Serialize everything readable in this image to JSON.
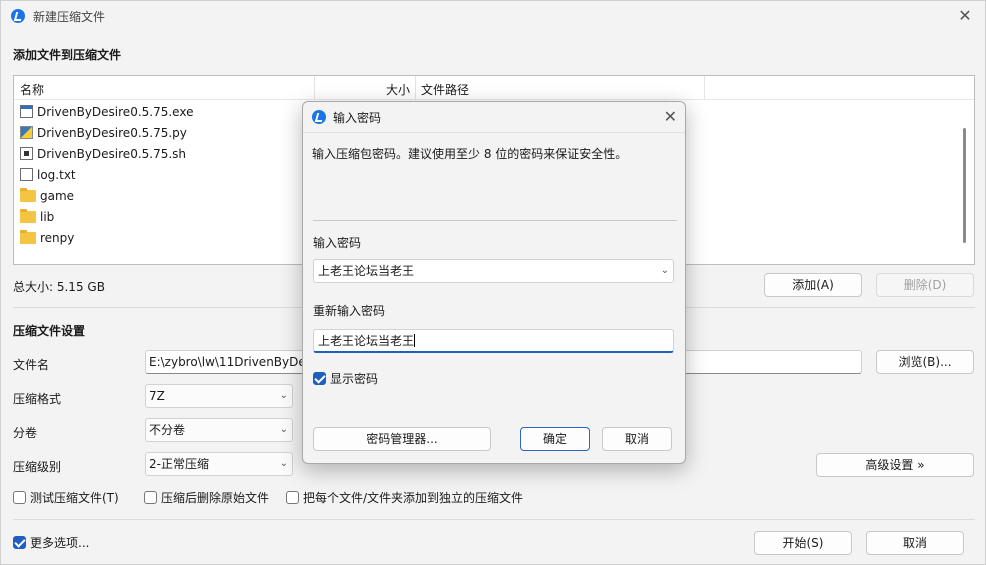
{
  "window": {
    "title": "新建压缩文件",
    "close_symbol": "✕",
    "add_section_title": "添加文件到压缩文件",
    "list": {
      "columns": [
        "名称",
        "大小",
        "文件路径"
      ],
      "rows": [
        {
          "name": "DrivenByDesire0.5.75.exe",
          "icon": "exe-file-icon"
        },
        {
          "name": "DrivenByDesire0.5.75.py",
          "icon": "python-file-icon"
        },
        {
          "name": "DrivenByDesire0.5.75.sh",
          "icon": "shell-file-icon"
        },
        {
          "name": "log.txt",
          "icon": "text-file-icon"
        },
        {
          "name": "game",
          "icon": "folder-icon"
        },
        {
          "name": "lib",
          "icon": "folder-icon"
        },
        {
          "name": "renpy",
          "icon": "folder-icon"
        }
      ]
    },
    "total_size": "总大小: 5.15 GB",
    "add_button": "添加(A)",
    "delete_button": "删除(D)",
    "settings_title": "压缩文件设置",
    "filename_label": "文件名",
    "filename_value": "E:\\zybro\\lw\\11DrivenByDesi",
    "browse_button": "浏览(B)...",
    "format_label": "压缩格式",
    "format_value": "7Z",
    "split_label": "分卷",
    "split_value": "不分卷",
    "level_label": "压缩级别",
    "level_value": "2-正常压缩",
    "advanced_button": "高级设置 »",
    "test_checkbox": "测试压缩文件(T)",
    "delete_after_checkbox": "压缩后删除原始文件",
    "separate_checkbox": "把每个文件/文件夹添加到独立的压缩文件",
    "more_options": "更多选项...",
    "start_button": "开始(S)",
    "cancel_button": "取消"
  },
  "dialog": {
    "title": "输入密码",
    "close_symbol": "✕",
    "description": "输入压缩包密码。建议使用至少 8 位的密码来保证安全性。",
    "password_label": "输入密码",
    "password_value": "上老王论坛当老王",
    "confirm_label": "重新输入密码",
    "confirm_value": "上老王论坛当老王",
    "show_password": "显示密码",
    "manager_button": "密码管理器...",
    "ok_button": "确定",
    "cancel_button": "取消"
  },
  "colors": {
    "accent": "#1f5fbf",
    "window_bg": "#f3f3f3"
  }
}
